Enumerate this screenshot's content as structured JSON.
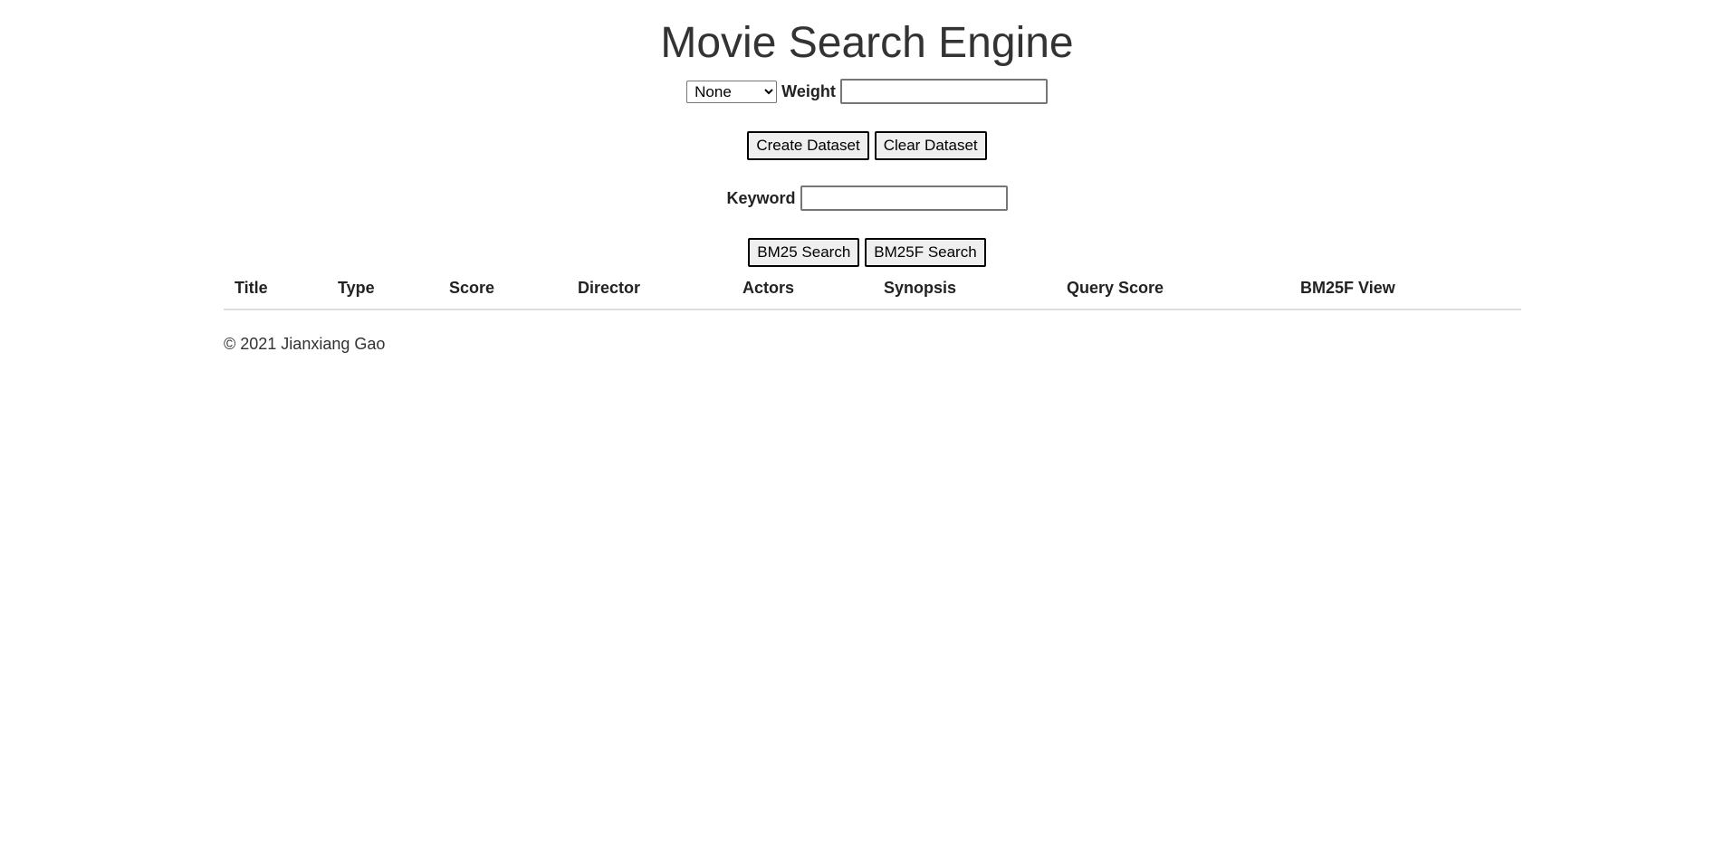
{
  "header": {
    "title": "Movie Search Engine"
  },
  "weight_row": {
    "field_select_value": "None",
    "weight_label": "Weight",
    "weight_value": ""
  },
  "dataset": {
    "create_label": "Create Dataset",
    "clear_label": "Clear Dataset"
  },
  "keyword_row": {
    "label": "Keyword",
    "value": ""
  },
  "search": {
    "bm25_label": "BM25 Search",
    "bm25f_label": "BM25F Search"
  },
  "results": {
    "columns": [
      "Title",
      "Type",
      "Score",
      "Director",
      "Actors",
      "Synopsis",
      "Query Score",
      "BM25F View"
    ]
  },
  "footer": {
    "text": "© 2021 Jianxiang Gao"
  }
}
